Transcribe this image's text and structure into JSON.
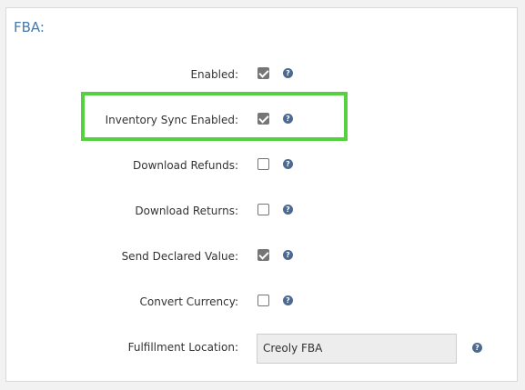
{
  "section": {
    "title": "FBA:"
  },
  "settings": [
    {
      "label": "Enabled:",
      "checked": true
    },
    {
      "label": "Inventory Sync Enabled:",
      "checked": true
    },
    {
      "label": "Download Refunds:",
      "checked": false
    },
    {
      "label": "Download Returns:",
      "checked": false
    },
    {
      "label": "Send Declared Value:",
      "checked": true
    },
    {
      "label": "Convert Currency:",
      "checked": false
    }
  ],
  "fulfillment_location": {
    "label": "Fulfillment Location:",
    "value": "Creoly FBA"
  },
  "help_glyph": "?",
  "colors": {
    "title": "#3f7cb0",
    "highlight": "#55d13f",
    "help_icon": "#4a6a92"
  }
}
